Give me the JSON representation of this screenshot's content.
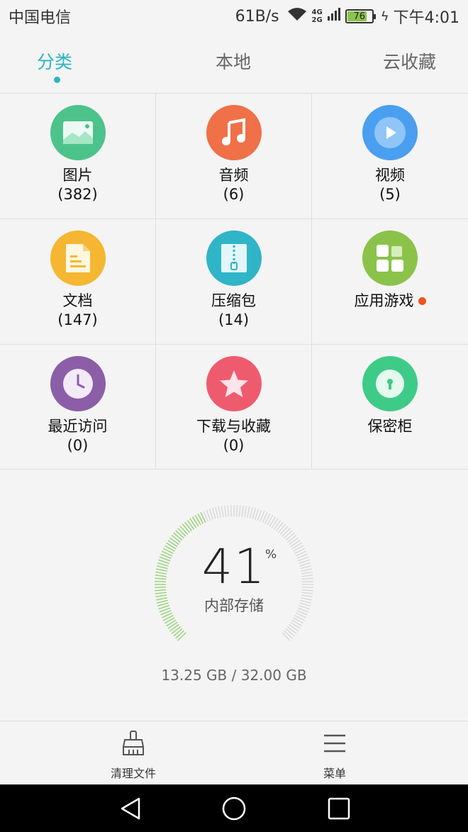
{
  "status_bar": {
    "carrier": "中国电信",
    "net_speed": "61B/s",
    "net_4g": "4G",
    "net_2g": "2G",
    "battery": "76",
    "time": "下午4:01"
  },
  "tabs": [
    {
      "label": "分类",
      "active": true
    },
    {
      "label": "本地",
      "active": false
    },
    {
      "label": "云收藏",
      "active": false
    }
  ],
  "categories": [
    {
      "label": "图片",
      "count": "(382)",
      "icon": "image-icon",
      "color": "#4cc38a"
    },
    {
      "label": "音频",
      "count": "(6)",
      "icon": "music-icon",
      "color": "#f07048"
    },
    {
      "label": "视频",
      "count": "(5)",
      "icon": "video-icon",
      "color": "#4a9ff0"
    },
    {
      "label": "文档",
      "count": "(147)",
      "icon": "document-icon",
      "color": "#f5b731"
    },
    {
      "label": "压缩包",
      "count": "(14)",
      "icon": "zip-icon",
      "color": "#2fb5c7"
    },
    {
      "label": "应用游戏",
      "count": "",
      "icon": "apps-icon",
      "color": "#8bc34a",
      "badge": true
    },
    {
      "label": "最近访问",
      "count": "(0)",
      "icon": "clock-icon",
      "color": "#8b5ea7"
    },
    {
      "label": "下载与收藏",
      "count": "(0)",
      "icon": "star-icon",
      "color": "#ef5b6e"
    },
    {
      "label": "保密柜",
      "count": "",
      "icon": "lock-icon",
      "color": "#3ecb88"
    }
  ],
  "storage": {
    "percent": "41",
    "percent_sign": "%",
    "usage": 0.41,
    "name": "内部存储",
    "size": "13.25 GB / 32.00 GB",
    "used_color": "#8bd06a",
    "free_color": "#d6d6d6"
  },
  "actions": {
    "clean": "清理文件",
    "menu": "菜单"
  },
  "nav": {
    "back": "back-icon",
    "home": "home-icon",
    "recent": "recent-apps-icon"
  }
}
